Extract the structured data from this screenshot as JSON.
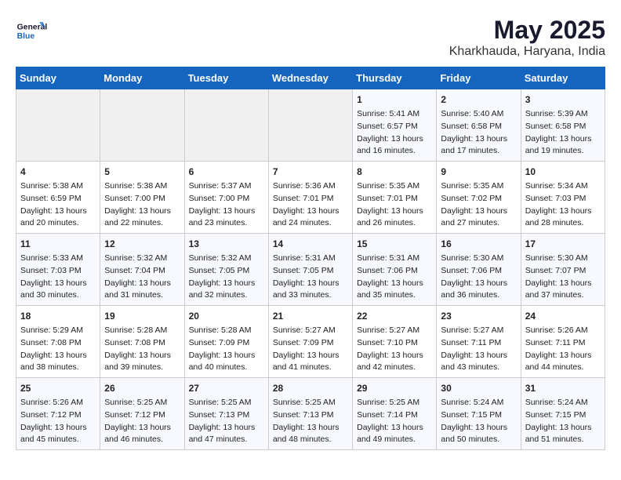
{
  "header": {
    "logo_line1": "General",
    "logo_line2": "Blue",
    "month_title": "May 2025",
    "location": "Kharkhauda, Haryana, India"
  },
  "days_of_week": [
    "Sunday",
    "Monday",
    "Tuesday",
    "Wednesday",
    "Thursday",
    "Friday",
    "Saturday"
  ],
  "weeks": [
    [
      {
        "day": "",
        "info": ""
      },
      {
        "day": "",
        "info": ""
      },
      {
        "day": "",
        "info": ""
      },
      {
        "day": "",
        "info": ""
      },
      {
        "day": "1",
        "info": "Sunrise: 5:41 AM\nSunset: 6:57 PM\nDaylight: 13 hours\nand 16 minutes."
      },
      {
        "day": "2",
        "info": "Sunrise: 5:40 AM\nSunset: 6:58 PM\nDaylight: 13 hours\nand 17 minutes."
      },
      {
        "day": "3",
        "info": "Sunrise: 5:39 AM\nSunset: 6:58 PM\nDaylight: 13 hours\nand 19 minutes."
      }
    ],
    [
      {
        "day": "4",
        "info": "Sunrise: 5:38 AM\nSunset: 6:59 PM\nDaylight: 13 hours\nand 20 minutes."
      },
      {
        "day": "5",
        "info": "Sunrise: 5:38 AM\nSunset: 7:00 PM\nDaylight: 13 hours\nand 22 minutes."
      },
      {
        "day": "6",
        "info": "Sunrise: 5:37 AM\nSunset: 7:00 PM\nDaylight: 13 hours\nand 23 minutes."
      },
      {
        "day": "7",
        "info": "Sunrise: 5:36 AM\nSunset: 7:01 PM\nDaylight: 13 hours\nand 24 minutes."
      },
      {
        "day": "8",
        "info": "Sunrise: 5:35 AM\nSunset: 7:01 PM\nDaylight: 13 hours\nand 26 minutes."
      },
      {
        "day": "9",
        "info": "Sunrise: 5:35 AM\nSunset: 7:02 PM\nDaylight: 13 hours\nand 27 minutes."
      },
      {
        "day": "10",
        "info": "Sunrise: 5:34 AM\nSunset: 7:03 PM\nDaylight: 13 hours\nand 28 minutes."
      }
    ],
    [
      {
        "day": "11",
        "info": "Sunrise: 5:33 AM\nSunset: 7:03 PM\nDaylight: 13 hours\nand 30 minutes."
      },
      {
        "day": "12",
        "info": "Sunrise: 5:32 AM\nSunset: 7:04 PM\nDaylight: 13 hours\nand 31 minutes."
      },
      {
        "day": "13",
        "info": "Sunrise: 5:32 AM\nSunset: 7:05 PM\nDaylight: 13 hours\nand 32 minutes."
      },
      {
        "day": "14",
        "info": "Sunrise: 5:31 AM\nSunset: 7:05 PM\nDaylight: 13 hours\nand 33 minutes."
      },
      {
        "day": "15",
        "info": "Sunrise: 5:31 AM\nSunset: 7:06 PM\nDaylight: 13 hours\nand 35 minutes."
      },
      {
        "day": "16",
        "info": "Sunrise: 5:30 AM\nSunset: 7:06 PM\nDaylight: 13 hours\nand 36 minutes."
      },
      {
        "day": "17",
        "info": "Sunrise: 5:30 AM\nSunset: 7:07 PM\nDaylight: 13 hours\nand 37 minutes."
      }
    ],
    [
      {
        "day": "18",
        "info": "Sunrise: 5:29 AM\nSunset: 7:08 PM\nDaylight: 13 hours\nand 38 minutes."
      },
      {
        "day": "19",
        "info": "Sunrise: 5:28 AM\nSunset: 7:08 PM\nDaylight: 13 hours\nand 39 minutes."
      },
      {
        "day": "20",
        "info": "Sunrise: 5:28 AM\nSunset: 7:09 PM\nDaylight: 13 hours\nand 40 minutes."
      },
      {
        "day": "21",
        "info": "Sunrise: 5:27 AM\nSunset: 7:09 PM\nDaylight: 13 hours\nand 41 minutes."
      },
      {
        "day": "22",
        "info": "Sunrise: 5:27 AM\nSunset: 7:10 PM\nDaylight: 13 hours\nand 42 minutes."
      },
      {
        "day": "23",
        "info": "Sunrise: 5:27 AM\nSunset: 7:11 PM\nDaylight: 13 hours\nand 43 minutes."
      },
      {
        "day": "24",
        "info": "Sunrise: 5:26 AM\nSunset: 7:11 PM\nDaylight: 13 hours\nand 44 minutes."
      }
    ],
    [
      {
        "day": "25",
        "info": "Sunrise: 5:26 AM\nSunset: 7:12 PM\nDaylight: 13 hours\nand 45 minutes."
      },
      {
        "day": "26",
        "info": "Sunrise: 5:25 AM\nSunset: 7:12 PM\nDaylight: 13 hours\nand 46 minutes."
      },
      {
        "day": "27",
        "info": "Sunrise: 5:25 AM\nSunset: 7:13 PM\nDaylight: 13 hours\nand 47 minutes."
      },
      {
        "day": "28",
        "info": "Sunrise: 5:25 AM\nSunset: 7:13 PM\nDaylight: 13 hours\nand 48 minutes."
      },
      {
        "day": "29",
        "info": "Sunrise: 5:25 AM\nSunset: 7:14 PM\nDaylight: 13 hours\nand 49 minutes."
      },
      {
        "day": "30",
        "info": "Sunrise: 5:24 AM\nSunset: 7:15 PM\nDaylight: 13 hours\nand 50 minutes."
      },
      {
        "day": "31",
        "info": "Sunrise: 5:24 AM\nSunset: 7:15 PM\nDaylight: 13 hours\nand 51 minutes."
      }
    ]
  ]
}
